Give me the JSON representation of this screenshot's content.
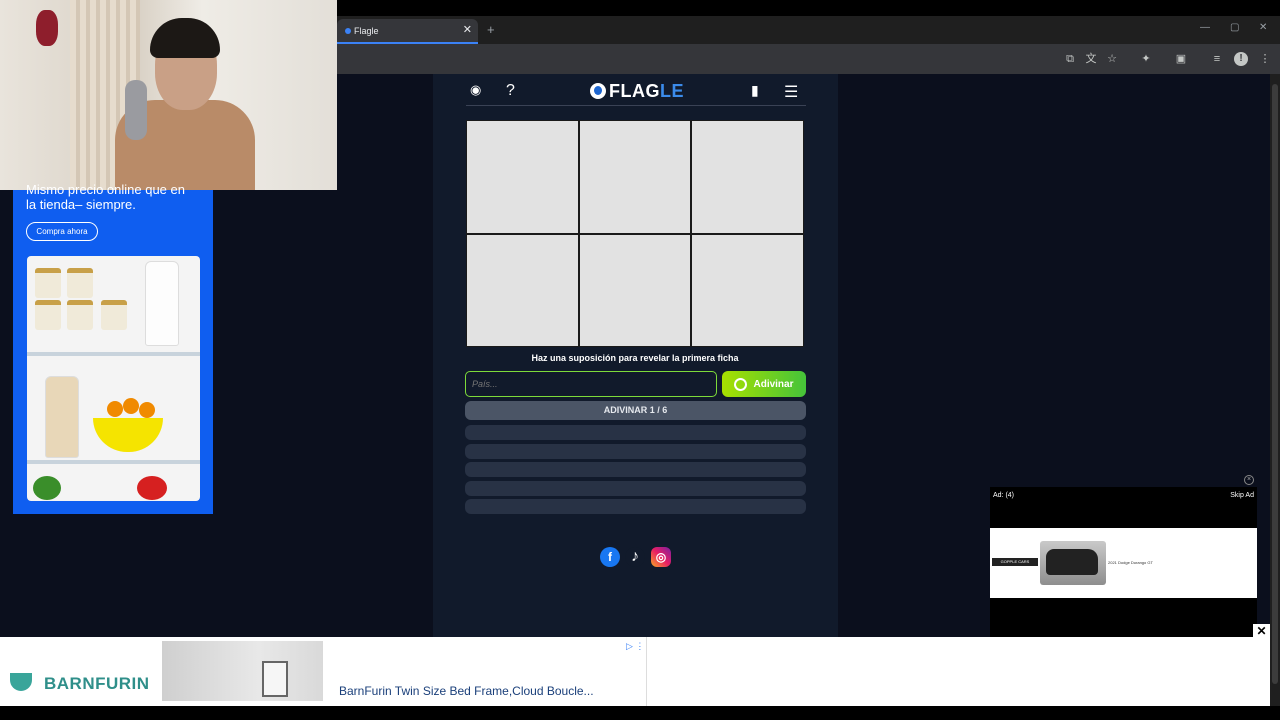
{
  "browser": {
    "tab_title": "Flagle",
    "tab_close": "✕",
    "new_tab": "+",
    "window_controls": [
      "—",
      "▢",
      "✕"
    ]
  },
  "left_ad": {
    "headline": "Mismo precio online que en la tienda– siempre.",
    "cta": "Compra ahora"
  },
  "game": {
    "logo_main": "FLAG",
    "logo_accent": "LE",
    "hint": "Haz una suposición para revelar la primera ficha",
    "input_placeholder": "País...",
    "guess_button": "Adivinar",
    "counter": "ADIVINAR 1 / 6",
    "tiles": 6,
    "empty_slots": 5,
    "icons": {
      "user": "user-icon",
      "help": "?",
      "stats": "bar-chart-icon",
      "menu": "☰"
    }
  },
  "social": {
    "facebook": "f",
    "tiktok": "♪",
    "instagram": "◎"
  },
  "video_ad": {
    "label": "Ad: (4)",
    "skip": "Skip Ad",
    "dealer": "GOPPLE CARS",
    "car_text": "2021 Dodge Durango GT"
  },
  "bottom_ad": {
    "brand": "BARNFURIN",
    "title": "BarnFurin Twin Size Bed Frame,Cloud Boucle...",
    "close": "✕"
  },
  "colors": {
    "page_bg": "#0b0f1d",
    "panel_bg": "#111a2b",
    "accent_green": "#7ddb3a",
    "logo_blue": "#3b8bea",
    "ad_blue": "#0f5ef0"
  }
}
